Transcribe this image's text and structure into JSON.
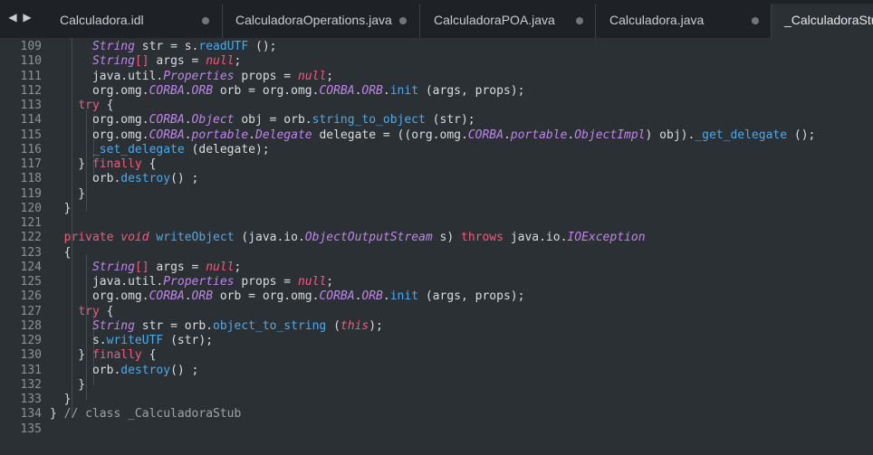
{
  "tabs": [
    {
      "label": "Calculadora.idl",
      "modified": true
    },
    {
      "label": "CalculadoraOperations.java",
      "modified": true
    },
    {
      "label": "CalculadoraPOA.java",
      "modified": true
    },
    {
      "label": "Calculadora.java",
      "modified": true
    },
    {
      "label": "_CalculadoraStub.java",
      "active": true
    }
  ],
  "nav": {
    "back_icon": "triangle-left",
    "forward_icon": "triangle-right"
  },
  "colors": {
    "background": "#2b3035",
    "tabbar": "#1e2226",
    "keyword": "#f25a7c",
    "type": "#c085e8",
    "function": "#4fa9e8",
    "text": "#dcdcdc",
    "line_number": "#8d9196"
  },
  "lines": [
    {
      "n": "109",
      "tokens": [
        [
          "pl",
          "      "
        ],
        [
          "ty",
          "String"
        ],
        [
          "pl",
          " str = s."
        ],
        [
          "fn",
          "readUTF"
        ],
        [
          "pl",
          " ();"
        ]
      ]
    },
    {
      "n": "110",
      "tokens": [
        [
          "pl",
          "      "
        ],
        [
          "ty",
          "String"
        ],
        [
          "kw",
          "[]"
        ],
        [
          "pl",
          " args = "
        ],
        [
          "nu",
          "null"
        ],
        [
          "pl",
          ";"
        ]
      ]
    },
    {
      "n": "111",
      "tokens": [
        [
          "pl",
          "      java.util."
        ],
        [
          "ty",
          "Properties"
        ],
        [
          "pl",
          " props = "
        ],
        [
          "nu",
          "null"
        ],
        [
          "pl",
          ";"
        ]
      ]
    },
    {
      "n": "112",
      "tokens": [
        [
          "pl",
          "      org.omg."
        ],
        [
          "ty",
          "CORBA"
        ],
        [
          "pl",
          "."
        ],
        [
          "ty",
          "ORB"
        ],
        [
          "pl",
          " orb = org.omg."
        ],
        [
          "ty",
          "CORBA"
        ],
        [
          "pl",
          "."
        ],
        [
          "ty",
          "ORB"
        ],
        [
          "pl",
          "."
        ],
        [
          "fn",
          "init"
        ],
        [
          "pl",
          " (args, props);"
        ]
      ]
    },
    {
      "n": "113",
      "tokens": [
        [
          "pl",
          "    "
        ],
        [
          "kw",
          "try"
        ],
        [
          "pl",
          " {"
        ]
      ]
    },
    {
      "n": "114",
      "tokens": [
        [
          "pl",
          "      org.omg."
        ],
        [
          "ty",
          "CORBA"
        ],
        [
          "pl",
          "."
        ],
        [
          "ty",
          "Object"
        ],
        [
          "pl",
          " obj = orb."
        ],
        [
          "fn",
          "string_to_object"
        ],
        [
          "pl",
          " (str);"
        ]
      ]
    },
    {
      "n": "115",
      "tokens": [
        [
          "pl",
          "      org.omg."
        ],
        [
          "ty",
          "CORBA"
        ],
        [
          "pl",
          "."
        ],
        [
          "ty",
          "portable"
        ],
        [
          "pl",
          "."
        ],
        [
          "ty",
          "Delegate"
        ],
        [
          "pl",
          " delegate = ((org.omg."
        ],
        [
          "ty",
          "CORBA"
        ],
        [
          "pl",
          "."
        ],
        [
          "ty",
          "portable"
        ],
        [
          "pl",
          "."
        ],
        [
          "ty",
          "ObjectImpl"
        ],
        [
          "pl",
          ") obj)."
        ],
        [
          "fn",
          "_get_delegate"
        ],
        [
          "pl",
          " ();"
        ]
      ]
    },
    {
      "n": "116",
      "tokens": [
        [
          "pl",
          "      "
        ],
        [
          "fn",
          "_set_delegate"
        ],
        [
          "pl",
          " (delegate);"
        ]
      ]
    },
    {
      "n": "117",
      "tokens": [
        [
          "pl",
          "    } "
        ],
        [
          "kw",
          "finally"
        ],
        [
          "pl",
          " {"
        ]
      ]
    },
    {
      "n": "118",
      "tokens": [
        [
          "pl",
          "      orb."
        ],
        [
          "fn",
          "destroy"
        ],
        [
          "pl",
          "() ;"
        ]
      ]
    },
    {
      "n": "119",
      "tokens": [
        [
          "pl",
          "    }"
        ]
      ]
    },
    {
      "n": "120",
      "tokens": [
        [
          "pl",
          "  }"
        ]
      ]
    },
    {
      "n": "121",
      "tokens": [
        [
          "pl",
          ""
        ]
      ]
    },
    {
      "n": "122",
      "tokens": [
        [
          "pl",
          "  "
        ],
        [
          "kw",
          "private"
        ],
        [
          "pl",
          " "
        ],
        [
          "kwi",
          "void"
        ],
        [
          "pl",
          " "
        ],
        [
          "fn",
          "writeObject"
        ],
        [
          "pl",
          " (java.io."
        ],
        [
          "ty",
          "ObjectOutputStream"
        ],
        [
          "pl",
          " s) "
        ],
        [
          "kw",
          "throws"
        ],
        [
          "pl",
          " java.io."
        ],
        [
          "ty",
          "IOException"
        ]
      ]
    },
    {
      "n": "123",
      "tokens": [
        [
          "pl",
          "  {"
        ]
      ]
    },
    {
      "n": "124",
      "tokens": [
        [
          "pl",
          "      "
        ],
        [
          "ty",
          "String"
        ],
        [
          "kw",
          "[]"
        ],
        [
          "pl",
          " args = "
        ],
        [
          "nu",
          "null"
        ],
        [
          "pl",
          ";"
        ]
      ]
    },
    {
      "n": "125",
      "tokens": [
        [
          "pl",
          "      java.util."
        ],
        [
          "ty",
          "Properties"
        ],
        [
          "pl",
          " props = "
        ],
        [
          "nu",
          "null"
        ],
        [
          "pl",
          ";"
        ]
      ]
    },
    {
      "n": "126",
      "tokens": [
        [
          "pl",
          "      org.omg."
        ],
        [
          "ty",
          "CORBA"
        ],
        [
          "pl",
          "."
        ],
        [
          "ty",
          "ORB"
        ],
        [
          "pl",
          " orb = org.omg."
        ],
        [
          "ty",
          "CORBA"
        ],
        [
          "pl",
          "."
        ],
        [
          "ty",
          "ORB"
        ],
        [
          "pl",
          "."
        ],
        [
          "fn",
          "init"
        ],
        [
          "pl",
          " (args, props);"
        ]
      ]
    },
    {
      "n": "127",
      "tokens": [
        [
          "pl",
          "    "
        ],
        [
          "kw",
          "try"
        ],
        [
          "pl",
          " {"
        ]
      ]
    },
    {
      "n": "128",
      "tokens": [
        [
          "pl",
          "      "
        ],
        [
          "ty",
          "String"
        ],
        [
          "pl",
          " str = orb."
        ],
        [
          "fn",
          "object_to_string"
        ],
        [
          "pl",
          " ("
        ],
        [
          "nu",
          "this"
        ],
        [
          "pl",
          ");"
        ]
      ]
    },
    {
      "n": "129",
      "tokens": [
        [
          "pl",
          "      s."
        ],
        [
          "fn",
          "writeUTF"
        ],
        [
          "pl",
          " (str);"
        ]
      ]
    },
    {
      "n": "130",
      "tokens": [
        [
          "pl",
          "    } "
        ],
        [
          "kw",
          "finally"
        ],
        [
          "pl",
          " {"
        ]
      ]
    },
    {
      "n": "131",
      "tokens": [
        [
          "pl",
          "      orb."
        ],
        [
          "fn",
          "destroy"
        ],
        [
          "pl",
          "() ;"
        ]
      ]
    },
    {
      "n": "132",
      "tokens": [
        [
          "pl",
          "    }"
        ]
      ]
    },
    {
      "n": "133",
      "tokens": [
        [
          "pl",
          "  }"
        ]
      ]
    },
    {
      "n": "134",
      "tokens": [
        [
          "pl",
          "} "
        ],
        [
          "cm",
          "// class _CalculadoraStub"
        ]
      ]
    },
    {
      "n": "135",
      "tokens": [
        [
          "pl",
          ""
        ]
      ]
    }
  ]
}
